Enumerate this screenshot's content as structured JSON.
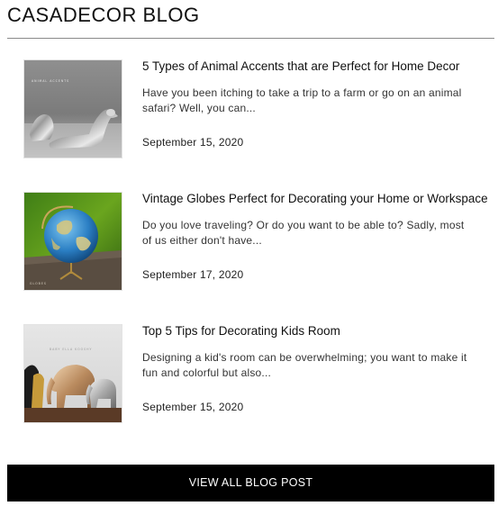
{
  "section": {
    "title": "CASADECOR BLOG"
  },
  "posts": [
    {
      "title": "5 Types of Animal Accents that are Perfect for Home Decor",
      "excerpt": "Have you been itching to take a trip to a farm or go on an animal safari? Well, you can...",
      "date": "September 15, 2020",
      "image_icon": "silver-dog-figurine-image",
      "image_caption": "ANIMAL ACCENTS"
    },
    {
      "title": "Vintage Globes Perfect for Decorating your Home or Workspace",
      "excerpt": "Do you love traveling? Or do you want to be able to? Sadly, most of us either don't have...",
      "date": "September 17, 2020",
      "image_icon": "globe-on-stand-image",
      "image_caption": "GLOBES"
    },
    {
      "title": "Top 5 Tips for Decorating Kids Room",
      "excerpt": "Designing a kid's room can be overwhelming; you want to make it fun and colorful but also...",
      "date": "September 15, 2020",
      "image_icon": "elephant-figurines-image",
      "image_caption": "BABY ELLA KOOSHY"
    }
  ],
  "footer": {
    "view_all_label": "VIEW ALL BLOG POST"
  },
  "colors": {
    "button_bg": "#000000",
    "button_text": "#ffffff",
    "rule": "#8a8a8a"
  }
}
